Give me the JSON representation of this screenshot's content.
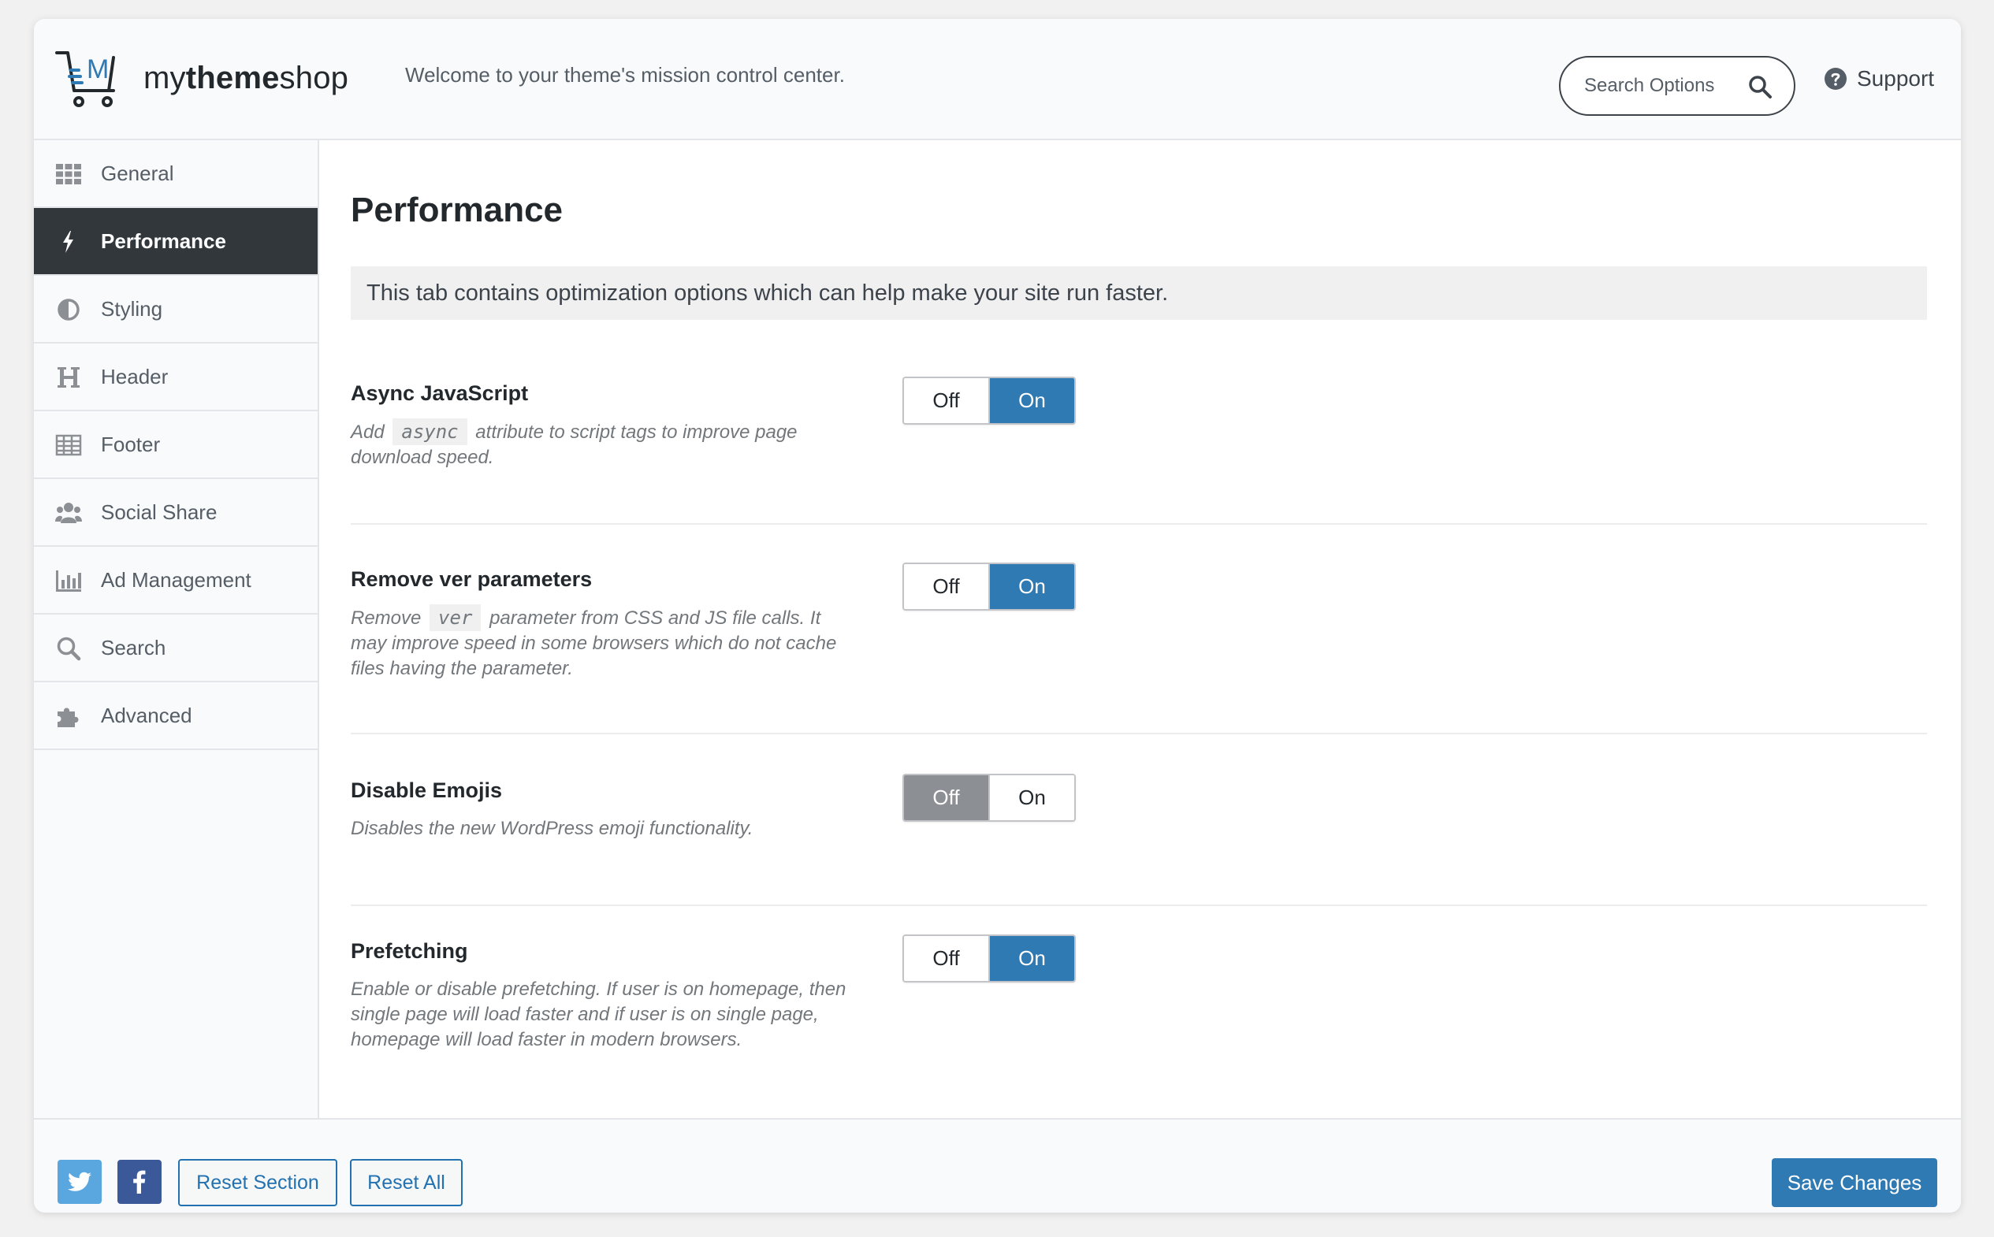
{
  "header": {
    "logo_text_prefix": "my",
    "logo_text_bold": "theme",
    "logo_text_suffix": "shop",
    "logo_icon": "cart-logo-icon",
    "welcome": "Welcome to your theme's mission control center.",
    "search_placeholder": "Search Options",
    "support_label": "Support"
  },
  "sidebar": {
    "items": [
      {
        "label": "General",
        "icon": "grid-icon"
      },
      {
        "label": "Performance",
        "icon": "bolt-icon",
        "active": true
      },
      {
        "label": "Styling",
        "icon": "contrast-icon"
      },
      {
        "label": "Header",
        "icon": "heading-icon"
      },
      {
        "label": "Footer",
        "icon": "table-icon"
      },
      {
        "label": "Social Share",
        "icon": "users-icon"
      },
      {
        "label": "Ad Management",
        "icon": "bar-chart-icon"
      },
      {
        "label": "Search",
        "icon": "search-icon"
      },
      {
        "label": "Advanced",
        "icon": "puzzle-icon"
      }
    ]
  },
  "main": {
    "title": "Performance",
    "description": "This tab contains optimization options which can help make your site run faster.",
    "options": [
      {
        "title": "Async JavaScript",
        "desc_before": "Add",
        "code": "async",
        "desc_after": "attribute to script tags to improve page download speed.",
        "off_label": "Off",
        "on_label": "On",
        "value": "On"
      },
      {
        "title": "Remove ver parameters",
        "desc_before": "Remove",
        "code": "ver",
        "desc_after": "parameter from CSS and JS file calls. It may improve speed in some browsers which do not cache files having the parameter.",
        "off_label": "Off",
        "on_label": "On",
        "value": "On"
      },
      {
        "title": "Disable Emojis",
        "desc": "Disables the new WordPress emoji functionality.",
        "off_label": "Off",
        "on_label": "On",
        "value": "Off"
      },
      {
        "title": "Prefetching",
        "desc": "Enable or disable prefetching. If user is on homepage, then single page will load faster and if user is on single page, homepage will load faster in modern browsers.",
        "off_label": "Off",
        "on_label": "On",
        "value": "On"
      }
    ]
  },
  "footer": {
    "twitter_icon": "twitter-icon",
    "facebook_icon": "facebook-icon",
    "reset_section_label": "Reset Section",
    "reset_all_label": "Reset All",
    "save_label": "Save Changes"
  },
  "colors": {
    "accent": "#2f7ab3",
    "active_nav_bg": "#32373c",
    "twitter": "#5aa7e0",
    "facebook": "#3b5998"
  }
}
